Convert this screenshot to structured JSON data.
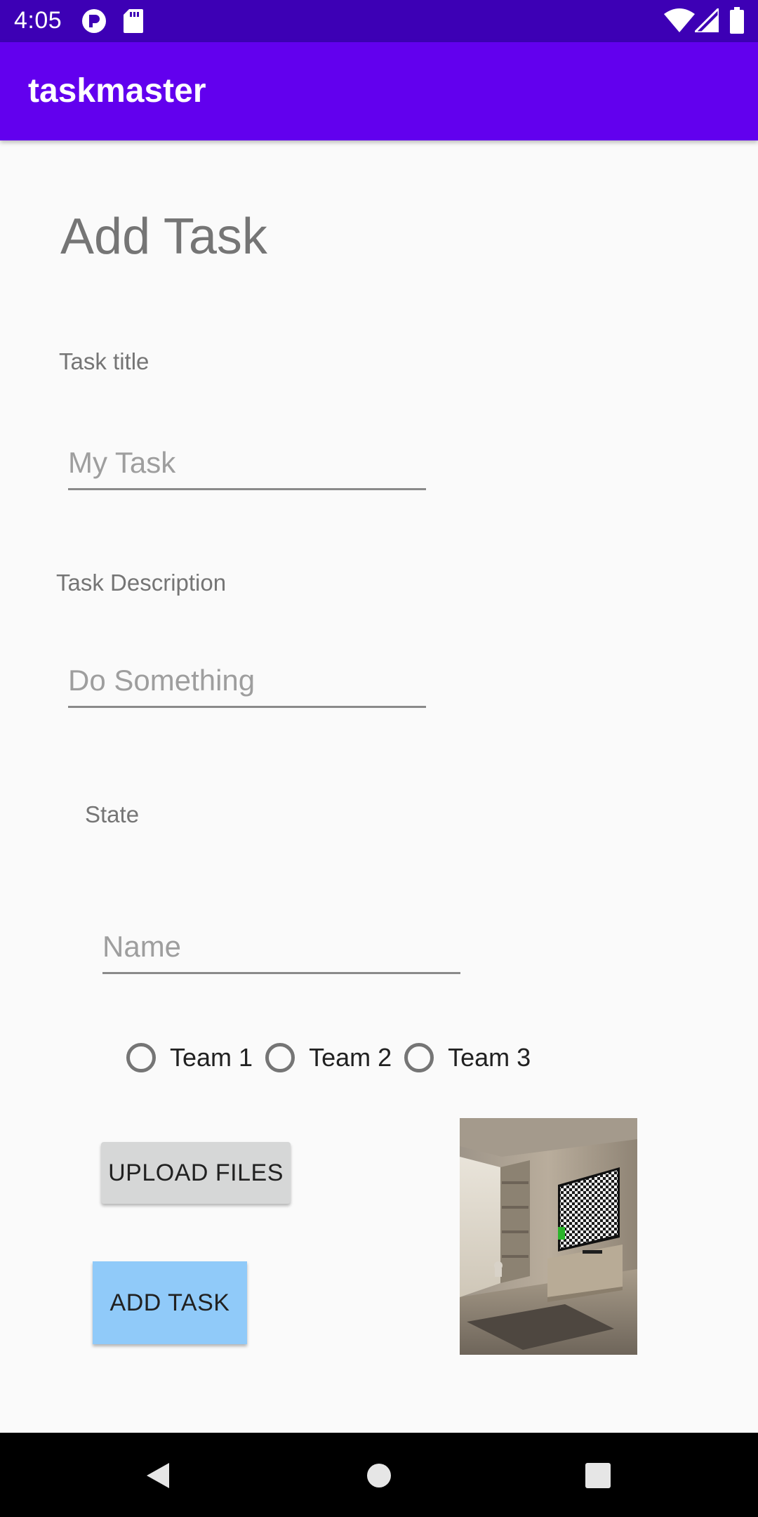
{
  "status_bar": {
    "time": "4:05",
    "icons": [
      "profile-badge-icon",
      "sd-card-icon",
      "wifi-icon",
      "cell-signal-icon",
      "battery-icon"
    ]
  },
  "app_bar": {
    "title": "taskmaster",
    "color": "#6200ee",
    "status_color": "#3d00b5"
  },
  "form": {
    "heading": "Add Task",
    "task_title_label": "Task title",
    "task_title_placeholder": "My Task",
    "task_title_value": "",
    "task_description_label": "Task Description",
    "task_description_placeholder": "Do Something",
    "task_description_value": "",
    "state_label": "State",
    "name_placeholder": "Name",
    "name_value": "",
    "teams": [
      {
        "label": "Team 1",
        "selected": false
      },
      {
        "label": "Team 2",
        "selected": false
      },
      {
        "label": "Team 3",
        "selected": false
      }
    ],
    "upload_button": "UPLOAD FILES",
    "add_button": "ADD TASK",
    "add_button_color": "#90caf9"
  },
  "nav_bar": {
    "buttons": [
      "back-icon",
      "home-icon",
      "recents-icon"
    ]
  }
}
